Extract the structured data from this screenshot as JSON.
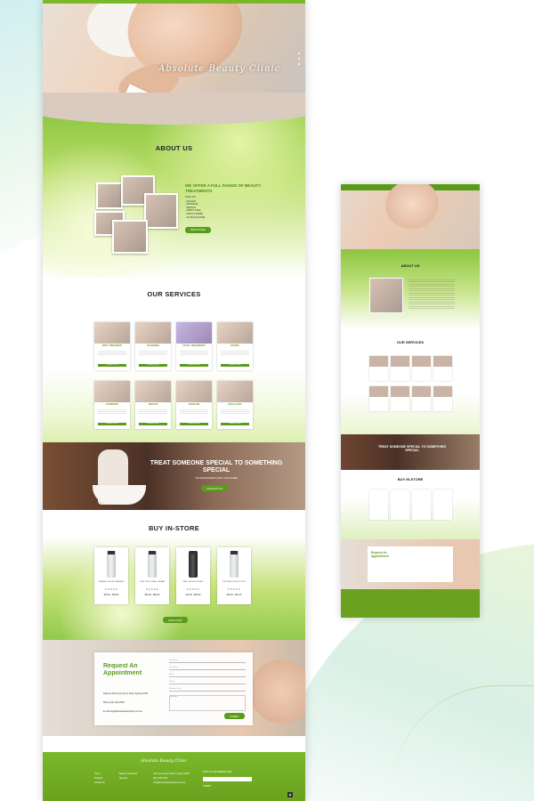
{
  "brand": {
    "logo_text": "Absolute Beauty Clinic",
    "accent": "#7ab82a",
    "dark_accent": "#5a9c19"
  },
  "about": {
    "title": "ABOUT US",
    "heading": "WE OFFER A FULL RANGE OF BEAUTY TREATMENTS",
    "intro": "SUCH AS:",
    "list": [
      "- FACIALS",
      "- MASSAGE",
      "- WAXING",
      "- SPRAY TANS",
      "- NAILS & MORE",
      "- SO MUCH MORE"
    ],
    "button": "READ MORE"
  },
  "services": {
    "title": "OUR SERVICES",
    "items": [
      {
        "label": "BODY TREATMENT",
        "button": "LEARN MORE"
      },
      {
        "label": "CLEANSING",
        "button": "LEARN MORE"
      },
      {
        "label": "FACIAL TREATMENTS",
        "button": "LEARN MORE"
      },
      {
        "label": "WAXING",
        "button": "LEARN MORE"
      },
      {
        "label": "EYEBROWS",
        "button": "LEARN MORE"
      },
      {
        "label": "MAKEUP",
        "button": "LEARN MORE"
      },
      {
        "label": "SKINCARE",
        "button": "LEARN MORE"
      },
      {
        "label": "NAILS & SPA",
        "button": "LEARN MORE"
      }
    ]
  },
  "voucher": {
    "title": "TREAT SOMEONE SPECIAL TO SOMETHING SPECIAL",
    "subtitle": "TO PURCHASE A GIFT VOUCHER",
    "button": "CONTACT US"
  },
  "store": {
    "title": "BUY IN-STORE",
    "products": [
      {
        "name": "DERMALOGICA CLEANSER",
        "stars": "★★★★★",
        "price": "$35.00 - $58.00"
      },
      {
        "name": "SKIN SMOOTHING CREAM",
        "stars": "★★★★★",
        "price": "$45.00 - $80.00"
      },
      {
        "name": "DAILY MICROFOLIANT",
        "stars": "★★★★★",
        "price": "$40.00 - $65.00"
      },
      {
        "name": "SPF FACE PROTECTION",
        "stars": "★★★★★",
        "price": "$32.00 - $54.00"
      }
    ],
    "button": "SHOP NOW"
  },
  "appointment": {
    "title": "Request An Appointment",
    "address_label": "Address",
    "address": "123 Lorem Ipsum Road, Sydney NSW",
    "phone_label": "Phone",
    "phone": "(02) 1234 5678",
    "email_label": "E-mail",
    "email": "info@absolutebeautyclinic.com.au",
    "fields": [
      "First Name",
      "Last Name",
      "Email",
      "Phone",
      "Preferred Date",
      "Message"
    ],
    "button": "SUBMIT"
  },
  "footer": {
    "logo_text": "Absolute Beauty Clinic",
    "col1": [
      "Home",
      "Products",
      "Contact Us"
    ],
    "col2": [
      "Beauty Treatments",
      "Specials"
    ],
    "col3": [
      "123 Lorem Ipsum Road, Sydney NSW",
      "(02) 1234 5678",
      "info@absolutebeautyclinic.com.au"
    ],
    "newsletter": "SIGN UP FOR NEWSLETTER",
    "subscribe": "SUBMIT",
    "top_icon": "▲"
  },
  "mini": {
    "about": "ABOUT US",
    "services": "OUR SERVICES",
    "voucher": "TREAT SOMEONE SPECIAL TO SOMETHING SPECIAL",
    "store": "BUY IN-STORE",
    "appt": "Request An Appointment"
  }
}
